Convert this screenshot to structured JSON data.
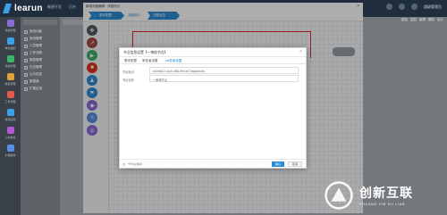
{
  "app": {
    "logo_text": "learun",
    "logo_suffix": "敏捷开发",
    "top_nav": [
      "后台",
      "开门指南",
      "工作流程",
      "功能模块",
      "系统设置",
      "数据管理"
    ],
    "user_name": "超级管理员"
  },
  "left_nav": [
    {
      "label": "系统管理",
      "color": "#8a6bd6"
    },
    {
      "label": "单位组织",
      "color": "#3aa0e8"
    },
    {
      "label": "系统管理",
      "color": "#3bb36a"
    },
    {
      "label": "报表管理",
      "color": "#e0a23a"
    },
    {
      "label": "工作流程",
      "color": "#e25a4d"
    },
    {
      "label": "移动应用",
      "color": "#3aa0e8"
    },
    {
      "label": "公共信息",
      "color": "#b05ad6"
    },
    {
      "label": "扩展组件",
      "color": "#5a8de0"
    }
  ],
  "tree": {
    "items": [
      "系统功能",
      "系统管理",
      "人员管理",
      "工作流程",
      "报表管理",
      "日志管理",
      "公共信息",
      "数据源",
      "扩展应用"
    ]
  },
  "right_toolbar": [
    "模板",
    "复制",
    "编辑",
    "删除",
    "设计"
  ],
  "window": {
    "title": "新增流程编辑 · 流程设计",
    "close": "×",
    "steps": [
      {
        "label": "基本配置",
        "state": "active"
      },
      {
        "label": "流程设计",
        "state": "idle"
      },
      {
        "label": "流程信息",
        "state": "active"
      }
    ],
    "start_node_label": "开始",
    "tool_icons": [
      {
        "name": "move-icon",
        "color": "#545a60",
        "glyph": "✥"
      },
      {
        "name": "direction-icon",
        "color": "#a64b3f",
        "glyph": "↗"
      },
      {
        "name": "start-icon",
        "color": "#3bb36a",
        "glyph": "▶"
      },
      {
        "name": "stop-icon",
        "color": "#e0321f",
        "glyph": "■"
      },
      {
        "name": "user-node-icon",
        "color": "#2d8cd6",
        "glyph": "♟"
      },
      {
        "name": "flow-node-icon",
        "color": "#2d8cd6",
        "glyph": "⚑"
      },
      {
        "name": "gateway-icon",
        "color": "#8a6bd6",
        "glyph": "◆"
      },
      {
        "name": "database-icon",
        "color": "#5a8de0",
        "glyph": "≡"
      },
      {
        "name": "sub-flow-icon",
        "color": "#8a6bd6",
        "glyph": "◎"
      }
    ]
  },
  "modal": {
    "title": "节点信息设置【一审核节点】",
    "close": "×",
    "tabs": [
      {
        "label": "基本配置",
        "active": false
      },
      {
        "label": "审批者设置",
        "active": false
      },
      {
        "label": "ssl表单设置",
        "active": true
      }
    ],
    "fields": [
      {
        "label": "节点标识",
        "value": "cb2b6d17-ac1b-4f82-99cf-f574aa8c60db"
      },
      {
        "label": "节点名称",
        "value": "一审核节点"
      }
    ],
    "footer_note": "注：*号为必填项",
    "ok": "确认",
    "cancel": "取消"
  },
  "watermark": {
    "cn": "创新互联",
    "en": "CHUANG XIN HU LIAN"
  }
}
